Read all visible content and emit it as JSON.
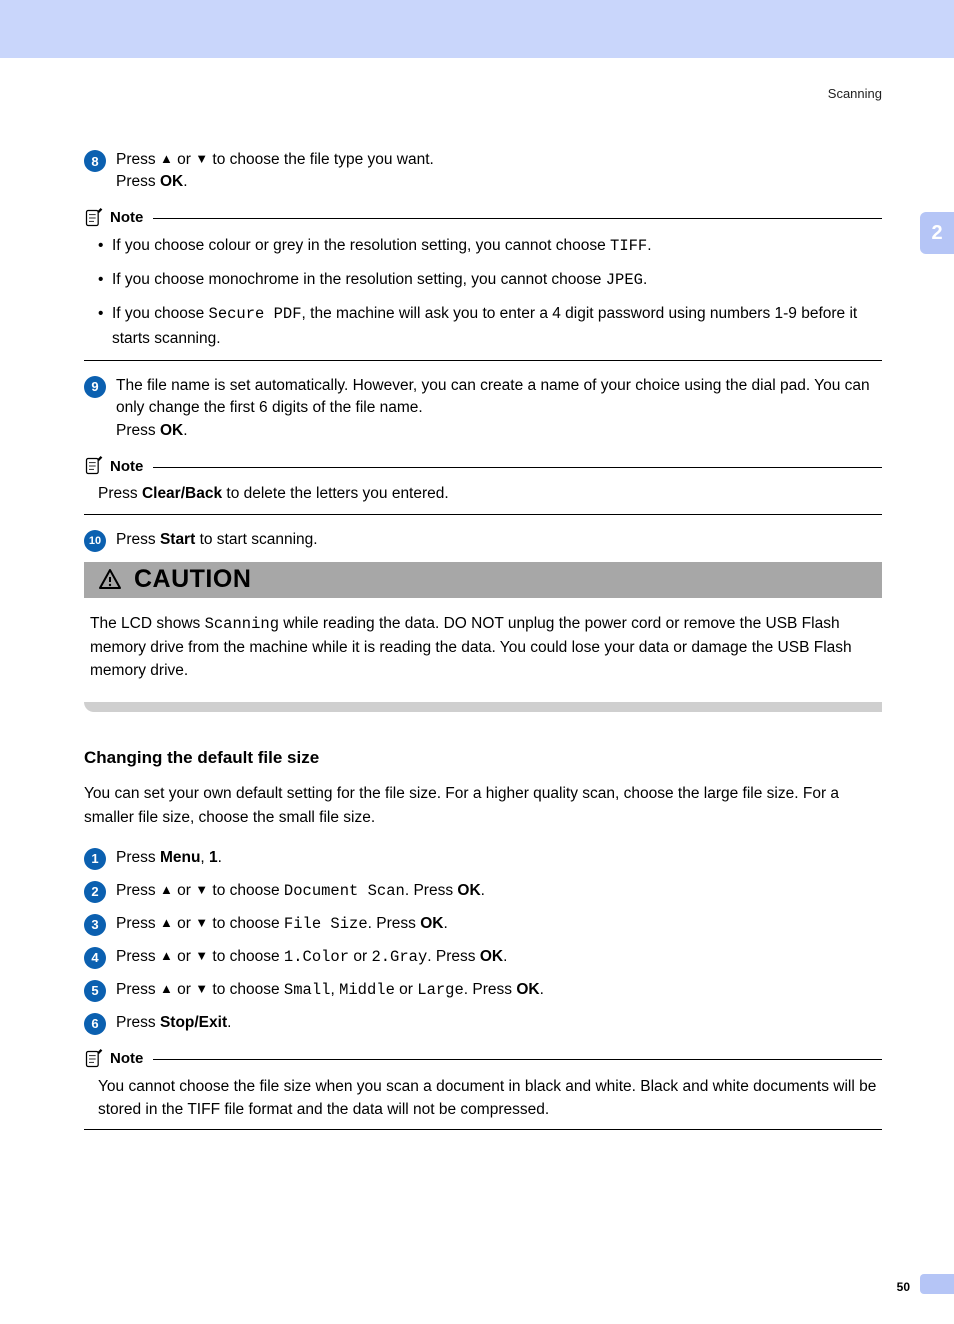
{
  "header": {
    "title": "Scanning"
  },
  "chapterTab": "2",
  "pageNumber": "50",
  "labels": {
    "note": "Note",
    "caution": "CAUTION"
  },
  "steps_top": [
    {
      "num": "8",
      "html": "Press <span class='arrow'>▲</span> or <span class='arrow'>▼</span> to choose the file type you want.<br>Press <span class='bold'>OK</span>."
    }
  ],
  "note1_items": [
    "If you choose colour or grey in the resolution setting, you cannot choose <span class='mono'>TIFF</span>.",
    "If you choose monochrome in the resolution setting, you cannot choose <span class='mono'>JPEG</span>.",
    "If you choose <span class='mono'>Secure PDF</span>, the machine will ask you to enter a 4 digit password using numbers 1-9 before it starts scanning."
  ],
  "step9": {
    "num": "9",
    "html": "The file name is set automatically. However, you can create a name of your choice using the dial pad. You can only change the first 6 digits of the file name.<br>Press <span class='bold'>OK</span>."
  },
  "note2_html": "Press <span class='bold'>Clear/Back</span> to delete the letters you entered.",
  "step10": {
    "num": "10",
    "html": "Press <span class='bold'>Start</span> to start scanning."
  },
  "caution_html": "The LCD shows <span class='mono'>Scanning</span> while reading the data. DO NOT unplug the power cord or remove the USB Flash memory drive from the machine while it is reading the data. You could lose your data or damage the USB Flash memory drive.",
  "section2": {
    "heading": "Changing the default file size",
    "intro": "You can set your own default setting for the file size. For a higher quality scan, choose the large file size. For a smaller file size, choose the small file size."
  },
  "steps_bottom": [
    {
      "num": "1",
      "html": "Press <span class='bold'>Menu</span>, <span class='bold'>1</span>."
    },
    {
      "num": "2",
      "html": "Press <span class='arrow'>▲</span> or <span class='arrow'>▼</span> to choose <span class='mono'>Document Scan</span>. Press <span class='bold'>OK</span>."
    },
    {
      "num": "3",
      "html": "Press <span class='arrow'>▲</span> or <span class='arrow'>▼</span> to choose <span class='mono'>File Size</span>. Press <span class='bold'>OK</span>."
    },
    {
      "num": "4",
      "html": "Press <span class='arrow'>▲</span> or <span class='arrow'>▼</span> to choose <span class='mono'>1.Color</span> or <span class='mono'>2.Gray</span>. Press <span class='bold'>OK</span>."
    },
    {
      "num": "5",
      "html": "Press <span class='arrow'>▲</span> or <span class='arrow'>▼</span> to choose <span class='mono'>Small</span>, <span class='mono'>Middle</span> or <span class='mono'>Large</span>. Press <span class='bold'>OK</span>."
    },
    {
      "num": "6",
      "html": "Press <span class='bold'>Stop/Exit</span>."
    }
  ],
  "note3_html": "You cannot choose the file size when you scan a document in black and white. Black and white documents will be stored in the TIFF file format and the data will not be compressed."
}
